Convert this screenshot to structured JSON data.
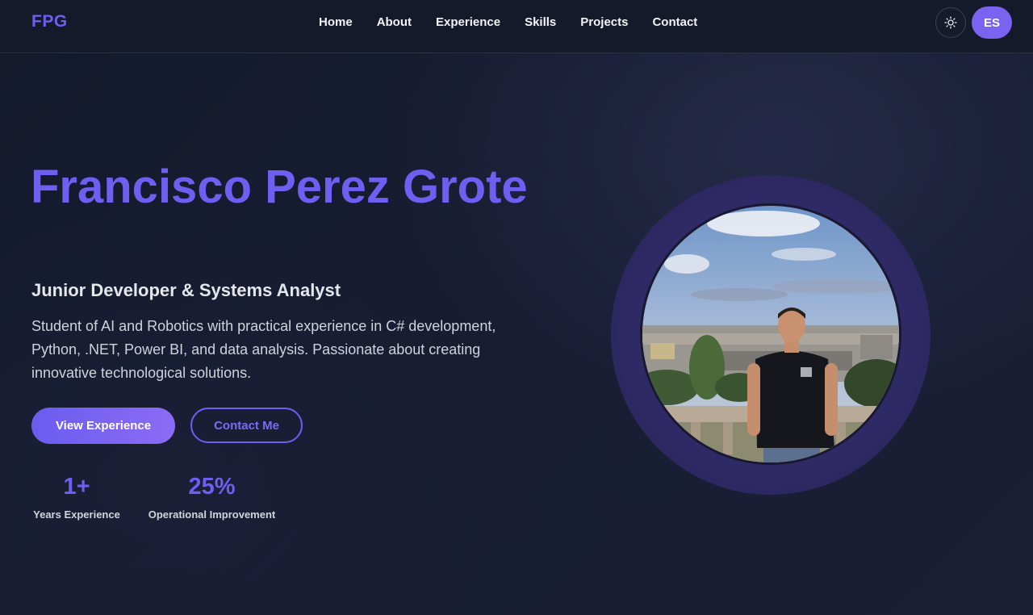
{
  "nav": {
    "logo": "FPG",
    "items": [
      "Home",
      "About",
      "Experience",
      "Skills",
      "Projects",
      "Contact"
    ],
    "theme_icon": "sun-icon",
    "language": "ES"
  },
  "hero": {
    "name": "Francisco Perez Grote",
    "role": "Junior Developer & Systems Analyst",
    "description": "Student of AI and Robotics with practical experience in C# development, Python, .NET, Power BI, and data analysis. Passionate about creating innovative technological solutions.",
    "primary_button": "View Experience",
    "secondary_button": "Contact Me",
    "stats": [
      {
        "value": "1+",
        "label": "Years Experience"
      },
      {
        "value": "25%",
        "label": "Operational Improvement"
      }
    ]
  },
  "colors": {
    "accent": "#6f5ff1",
    "background": "#151a2b"
  }
}
